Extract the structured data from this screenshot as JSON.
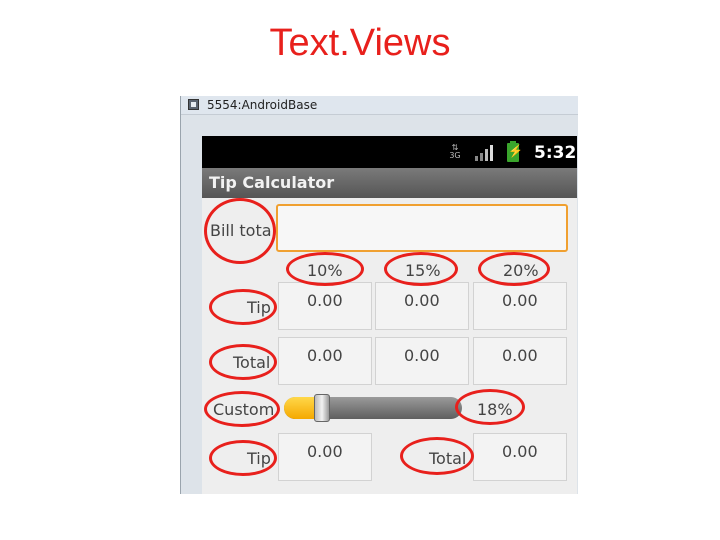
{
  "slide": {
    "title": "Text.Views"
  },
  "window": {
    "title": "5554:AndroidBase"
  },
  "statusbar": {
    "network": "3G",
    "time": "5:32"
  },
  "app": {
    "title": "Tip Calculator"
  },
  "bill": {
    "label": "Bill total",
    "value": ""
  },
  "percent_headers": [
    "10%",
    "15%",
    "20%"
  ],
  "rows": {
    "tip": {
      "label": "Tip",
      "values": [
        "0.00",
        "0.00",
        "0.00"
      ]
    },
    "total": {
      "label": "Total",
      "values": [
        "0.00",
        "0.00",
        "0.00"
      ]
    }
  },
  "custom": {
    "label": "Custom",
    "percent_label": "18%",
    "slider_fraction": 0.18,
    "tip_label": "Tip",
    "tip_value": "0.00",
    "total_label": "Total",
    "total_value": "0.00"
  },
  "colors": {
    "annotation": "#e8201c",
    "slider_fill": "#f5a800",
    "input_focus": "#f0a030"
  }
}
